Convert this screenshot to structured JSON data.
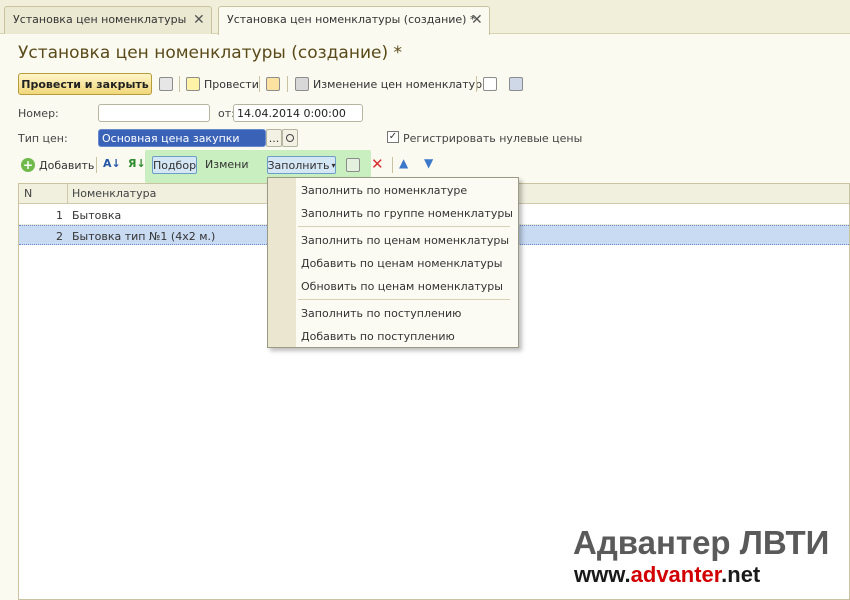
{
  "tabs": [
    {
      "label": "Установка цен номенклатуры",
      "close": "✕"
    },
    {
      "label": "Установка цен номенклатуры (создание) *",
      "close": "✕"
    }
  ],
  "page_title": "Установка цен номенклатуры (создание) *",
  "toolbar": {
    "post_close": "Провести и закрыть",
    "post": "Провести",
    "change_prices": "Изменение цен номенклатуры",
    "icons": [
      "save-icon",
      "post-icon",
      "dt-kt-icon",
      "printer-icon",
      "document-icon",
      "list-icon"
    ]
  },
  "form": {
    "number_label": "Номер:",
    "number_value": "",
    "date_label": "от:",
    "date_value": "14.04.2014  0:00:00",
    "price_type_label": "Тип цен:",
    "price_type_value": "Основная цена закупки",
    "ellipsis": "...",
    "register_zero_label": "Регистрировать нулевые цены",
    "register_zero_checked": true
  },
  "table_toolbar": {
    "add": "Добавить",
    "pick": "Подбор",
    "edit": "Изменить",
    "fill": "Заполнить"
  },
  "table": {
    "columns": [
      "N",
      "Номенклатура"
    ],
    "rows": [
      {
        "n": "1",
        "name": "Бытовка"
      },
      {
        "n": "2",
        "name": "Бытовка тип №1 (4x2 м.)"
      }
    ]
  },
  "fill_menu": {
    "groups": [
      [
        "Заполнить по номенклатуре",
        "Заполнить по группе номенклатуры"
      ],
      [
        "Заполнить по ценам номенклатуры",
        "Добавить по ценам номенклатуры",
        "Обновить по ценам номенклатуры"
      ],
      [
        "Заполнить по поступлению",
        "Добавить по поступлению"
      ]
    ]
  },
  "watermark": {
    "title": "Адвантер ЛВТИ",
    "url_prefix": "www.",
    "url_brand": "advanter",
    "url_suffix": ".net"
  },
  "colors": {
    "background": "#fbfaf0",
    "accent_primary": "#f0d77a",
    "selection": "#3a63b8",
    "highlight_green": "#c9efc0",
    "brand_red": "#d20000"
  }
}
